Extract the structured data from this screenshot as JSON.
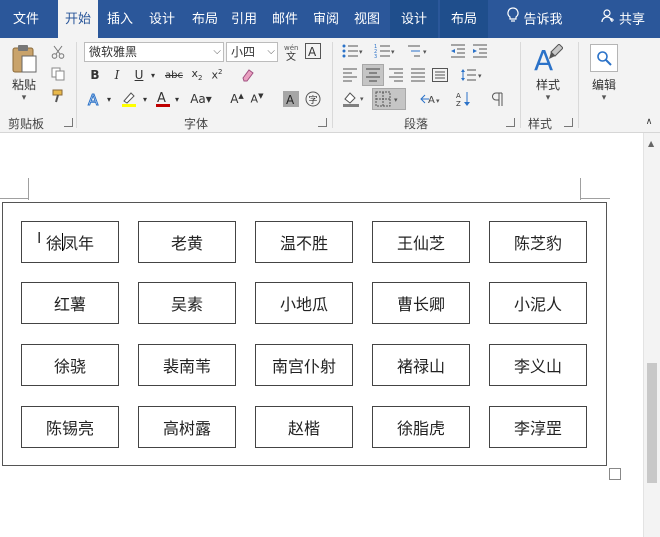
{
  "menu": {
    "tabs": [
      {
        "label": "文件"
      },
      {
        "label": "开始"
      },
      {
        "label": "插入"
      },
      {
        "label": "设计"
      },
      {
        "label": "布局"
      },
      {
        "label": "引用"
      },
      {
        "label": "邮件"
      },
      {
        "label": "审阅"
      },
      {
        "label": "视图"
      },
      {
        "label": "设计"
      },
      {
        "label": "布局"
      }
    ],
    "tell_me": "告诉我",
    "share": "共享"
  },
  "ribbon": {
    "clipboard": {
      "paste_label": "粘贴",
      "group_label": "剪贴板"
    },
    "font": {
      "font_name": "微软雅黑",
      "font_size": "小四",
      "group_label": "字体"
    },
    "paragraph": {
      "group_label": "段落"
    },
    "styles": {
      "styles_label": "样式",
      "group_label": "样式"
    },
    "editing": {
      "edit_label": "编辑"
    }
  },
  "table": {
    "rows": [
      [
        "徐凤年",
        "老黄",
        "温不胜",
        "王仙芝",
        "陈芝豹"
      ],
      [
        "红薯",
        "吴素",
        "小地瓜",
        "曹长卿",
        "小泥人"
      ],
      [
        "徐骁",
        "裴南苇",
        "南宫仆射",
        "褚禄山",
        "李义山"
      ],
      [
        "陈锡亮",
        "高树露",
        "赵楷",
        "徐脂虎",
        "李淳罡"
      ]
    ]
  },
  "colors": {
    "accent": "#2b579a",
    "ribbon_bg": "#f3f3f3"
  }
}
